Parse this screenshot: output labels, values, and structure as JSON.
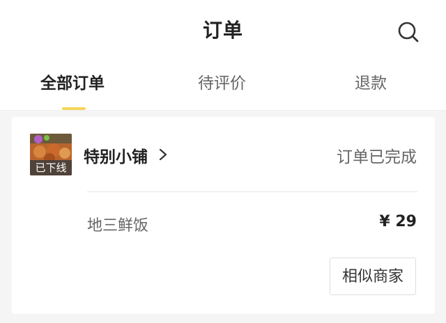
{
  "header": {
    "title": "订单",
    "search_icon": "search-icon"
  },
  "tabs": [
    {
      "label": "全部订单",
      "active": true
    },
    {
      "label": "待评价",
      "active": false
    },
    {
      "label": "退款",
      "active": false
    }
  ],
  "order": {
    "shop_name": "特别小铺",
    "thumbnail_badge": "已下线",
    "status": "订单已完成",
    "item_name": "地三鲜饭",
    "price": "¥ 29",
    "action_label": "相似商家"
  },
  "colors": {
    "accent": "#f5d65a",
    "background": "#f5f5f5"
  }
}
